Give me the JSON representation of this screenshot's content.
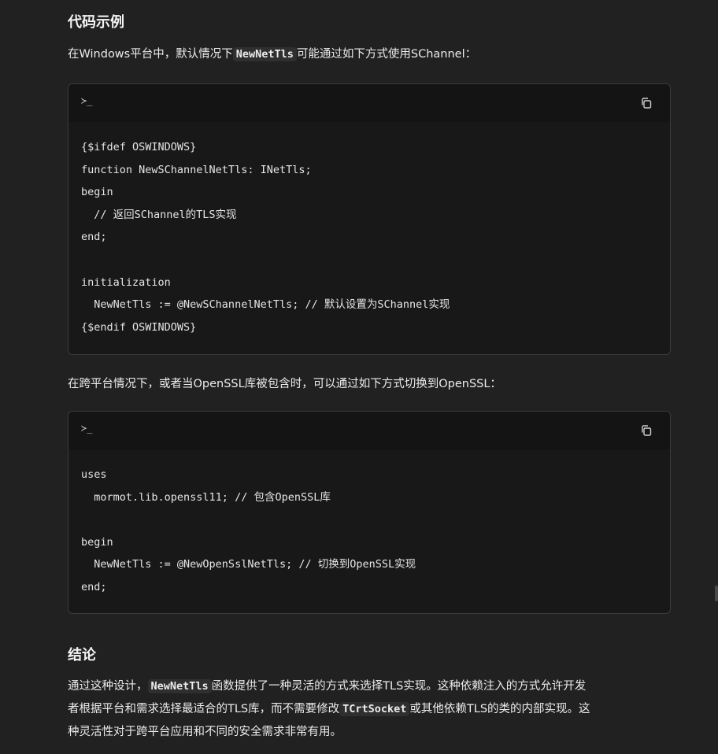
{
  "section1": {
    "heading": "代码示例",
    "intro_before": "在Windows平台中，默认情况下",
    "intro_code": "NewNetTls",
    "intro_after": "可能通过如下方式使用SChannel："
  },
  "code1": {
    "prompt": "≻_",
    "lines": [
      "{$ifdef OSWINDOWS}",
      "function NewSChannelNetTls: INetTls;",
      "begin",
      "  // 返回SChannel的TLS实现",
      "end;",
      "",
      "initialization",
      "  NewNetTls := @NewSChannelNetTls; // 默认设置为SChannel实现",
      "{$endif OSWINDOWS}"
    ]
  },
  "middle_para": "在跨平台情况下，或者当OpenSSL库被包含时，可以通过如下方式切换到OpenSSL：",
  "code2": {
    "prompt": "≻_",
    "lines": [
      "uses",
      "  mormot.lib.openssl11; // 包含OpenSSL库",
      "",
      "begin",
      "  NewNetTls := @NewOpenSslNetTls; // 切换到OpenSSL实现",
      "end;"
    ]
  },
  "section2": {
    "heading": "结论",
    "line1_before": "通过这种设计，",
    "line1_code": "NewNetTls",
    "line1_after": "函数提供了一种灵活的方式来选择TLS实现。这种依赖注入的方式允许开发",
    "line2_before": "者根据平台和需求选择最适合的TLS库，而不需要修改",
    "line2_code": "TCrtSocket",
    "line2_after": "或其他依赖TLS的类的内部实现。这",
    "line3": "种灵活性对于跨平台应用和不同的安全需求非常有用。"
  },
  "colors": {
    "background": "#212121",
    "code_background": "#181818",
    "text": "#ececec"
  },
  "icons": {
    "terminal": "terminal-prompt-icon",
    "copy": "copy-icon"
  }
}
